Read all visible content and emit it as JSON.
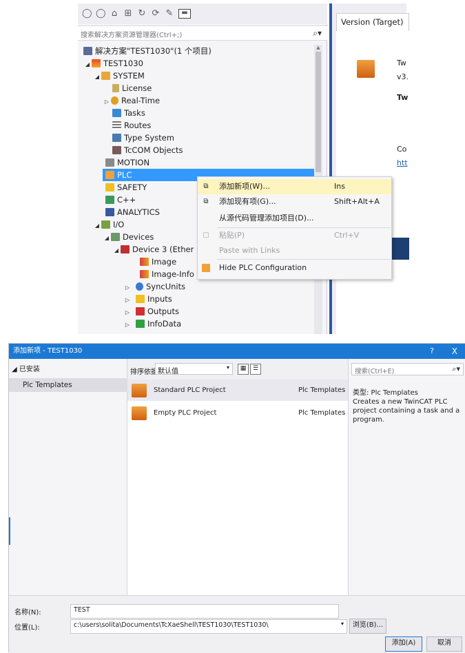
{
  "solution_explorer": {
    "search_placeholder": "搜索解决方案资源管理器(Ctrl+;)",
    "tree": [
      {
        "label": "解决方案\"TEST1030\"(1 个项目)",
        "icon": "solution-icon",
        "exp": ""
      },
      {
        "label": "TEST1030",
        "icon": "project-icon",
        "exp": "◢"
      },
      {
        "label": "SYSTEM",
        "icon": "system-icon",
        "exp": "◢"
      },
      {
        "label": "License",
        "icon": "license-icon",
        "exp": ""
      },
      {
        "label": "Real-Time",
        "icon": "realtime-icon",
        "exp": "▷"
      },
      {
        "label": "Tasks",
        "icon": "tasks-icon",
        "exp": ""
      },
      {
        "label": "Routes",
        "icon": "routes-icon",
        "exp": ""
      },
      {
        "label": "Type System",
        "icon": "type-system-icon",
        "exp": ""
      },
      {
        "label": "TcCOM Objects",
        "icon": "tccom-icon",
        "exp": ""
      },
      {
        "label": "MOTION",
        "icon": "motion-icon",
        "exp": ""
      },
      {
        "label": "PLC",
        "icon": "plc-icon",
        "exp": ""
      },
      {
        "label": "SAFETY",
        "icon": "safety-icon",
        "exp": ""
      },
      {
        "label": "C++",
        "icon": "cpp-icon",
        "exp": ""
      },
      {
        "label": "ANALYTICS",
        "icon": "analytics-icon",
        "exp": ""
      },
      {
        "label": "I/O",
        "icon": "io-icon",
        "exp": "◢"
      },
      {
        "label": "Devices",
        "icon": "devices-icon",
        "exp": "◢"
      },
      {
        "label": "Device 3 (Ether",
        "icon": "device-icon",
        "exp": "◢"
      },
      {
        "label": "Image",
        "icon": "image-icon",
        "exp": ""
      },
      {
        "label": "Image-Info",
        "icon": "image-info-icon",
        "exp": ""
      },
      {
        "label": "SyncUnits",
        "icon": "syncunits-icon",
        "exp": "▷"
      },
      {
        "label": "Inputs",
        "icon": "inputs-icon",
        "exp": "▷"
      },
      {
        "label": "Outputs",
        "icon": "outputs-icon",
        "exp": "▷"
      },
      {
        "label": "InfoData",
        "icon": "infodata-icon",
        "exp": "▷"
      }
    ]
  },
  "version_pane": {
    "tab_label": "Version (Target)",
    "line1": "Tw",
    "line2": "v3.",
    "line3": "Tw",
    "line4": "Co",
    "link": "htt"
  },
  "context_menu": {
    "items": [
      {
        "label": "添加新项(W)...",
        "shortcut": "Ins",
        "icon": "add-new-item-icon",
        "disabled": false
      },
      {
        "label": "添加现有项(G)...",
        "shortcut": "Shift+Alt+A",
        "icon": "add-existing-item-icon",
        "disabled": false
      },
      {
        "label": "从源代码管理添加项目(D)...",
        "shortcut": "",
        "icon": "",
        "disabled": false
      },
      {
        "label": "粘贴(P)",
        "shortcut": "Ctrl+V",
        "icon": "paste-icon",
        "disabled": true
      },
      {
        "label": "Paste with Links",
        "shortcut": "",
        "icon": "",
        "disabled": true
      },
      {
        "label": "Hide PLC Configuration",
        "shortcut": "",
        "icon": "hide-plc-icon",
        "disabled": false
      }
    ]
  },
  "dialog": {
    "title": "添加新项 - TEST1030",
    "help": "?",
    "close": "X",
    "installed": "◢ 已安装",
    "left_item": "Plc Templates",
    "sort_label": "排序依据:",
    "sort_value": "默认值",
    "search_placeholder": "搜索(Ctrl+E)",
    "templates": [
      {
        "name": "Standard PLC Project",
        "category": "Plc Templates"
      },
      {
        "name": "Empty PLC Project",
        "category": "Plc Templates"
      }
    ],
    "desc_type": "类型: Plc Templates",
    "desc_text": "Creates a new TwinCAT PLC project containing a task and a program.",
    "name_label": "名称(N):",
    "name_value": "TEST",
    "location_label": "位置(L):",
    "location_value": "c:\\users\\solita\\Documents\\TcXaeShell\\TEST1030\\TEST1030\\",
    "browse": "浏览(B)...",
    "add": "添加(A)",
    "cancel": "取消"
  }
}
